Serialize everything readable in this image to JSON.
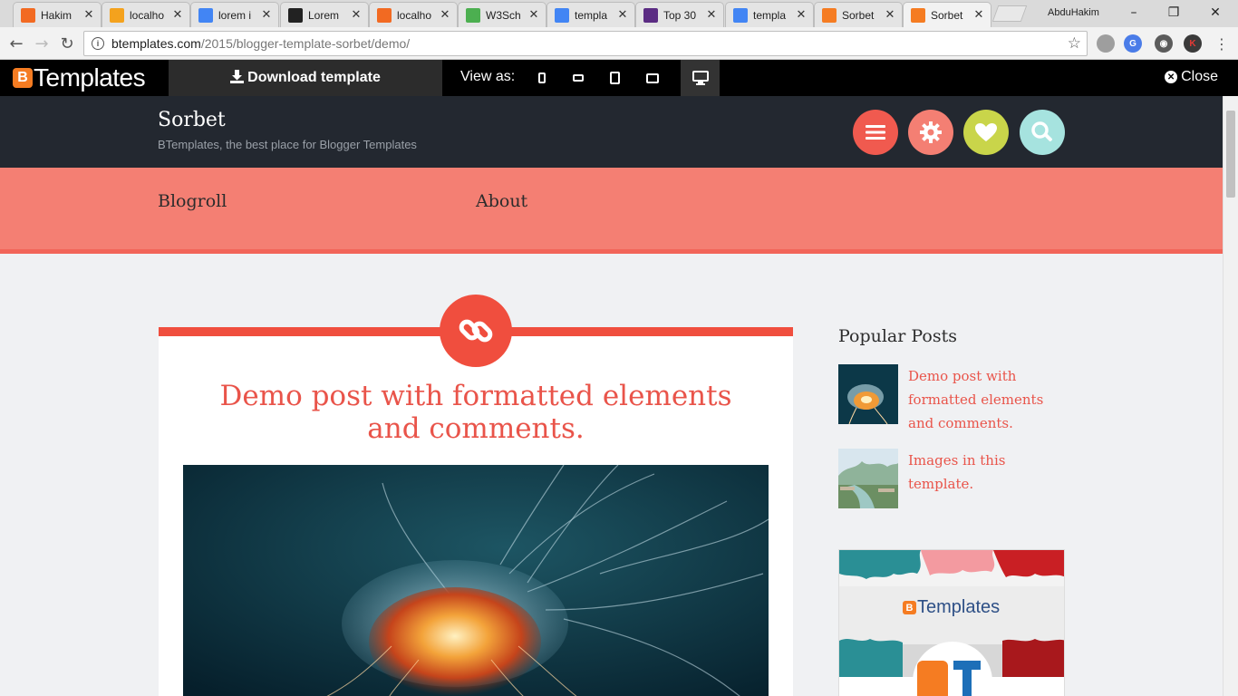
{
  "browser": {
    "tabs": [
      {
        "title": "Hakim",
        "icon": "xampp-icon",
        "color": "#f26a22"
      },
      {
        "title": "localho",
        "icon": "phpmyadmin-icon",
        "color": "#f4a21d"
      },
      {
        "title": "lorem i",
        "icon": "google-icon",
        "color": "#4285f4"
      },
      {
        "title": "Lorem",
        "icon": "lipsum-icon",
        "color": "#222222"
      },
      {
        "title": "localho",
        "icon": "xampp-icon",
        "color": "#f26a22"
      },
      {
        "title": "W3Sch",
        "icon": "w3schools-icon",
        "color": "#4caf50"
      },
      {
        "title": "templa",
        "icon": "google-icon",
        "color": "#4285f4"
      },
      {
        "title": "Top 30",
        "icon": "colorlib-icon",
        "color": "#5b2c83"
      },
      {
        "title": "templa",
        "icon": "google-icon",
        "color": "#4285f4"
      },
      {
        "title": "Sorbet",
        "icon": "btemplates-icon",
        "color": "#f57c22"
      },
      {
        "title": "Sorbet",
        "icon": "btemplates-icon",
        "color": "#f57c22",
        "active": true
      }
    ],
    "profile_name": "AbduHakim",
    "url_host": "btemplates.com",
    "url_path": "/2015/blogger-template-sorbet/demo/",
    "extensions": [
      "globe-extension-icon",
      "translate-extension-icon",
      "eye-extension-icon",
      "k-extension-icon"
    ]
  },
  "btbar": {
    "logo_letter": "B",
    "logo_text": "Templates",
    "download_label": "Download template",
    "view_as_label": "View as:",
    "close_label": "Close"
  },
  "site": {
    "title": "Sorbet",
    "description": "BTemplates, the best place for Blogger Templates",
    "header_icons": [
      {
        "name": "menu-icon",
        "color": "#f05a4f"
      },
      {
        "name": "gear-icon",
        "color": "#f47f73"
      },
      {
        "name": "heart-icon",
        "color": "#c9d54a"
      },
      {
        "name": "search-icon",
        "color": "#a6e3df"
      }
    ],
    "menu": [
      "Blogroll",
      "About"
    ],
    "accent": "#f04e3e"
  },
  "post": {
    "title": "Demo post with formatted elements and comments."
  },
  "sidebar": {
    "popular_title": "Popular Posts",
    "popular_posts": [
      {
        "title": "Demo post with formatted elements and comments."
      },
      {
        "title": "Images in this template."
      }
    ],
    "banner_brand_letter": "B",
    "banner_brand_text": "Templates"
  }
}
